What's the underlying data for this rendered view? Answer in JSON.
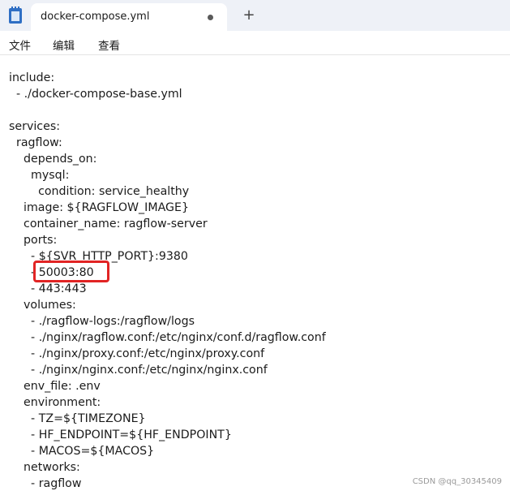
{
  "tab": {
    "title": "docker-compose.yml"
  },
  "menu": [
    "文件",
    "编辑",
    "查看"
  ],
  "lines": [
    "include:",
    "  - ./docker-compose-base.yml",
    "",
    "services:",
    "  ragflow:",
    "    depends_on:",
    "      mysql:",
    "        condition: service_healthy",
    "    image: ${RAGFLOW_IMAGE}",
    "    container_name: ragflow-server",
    "    ports:",
    "      - ${SVR_HTTP_PORT}:9380",
    "      - 50003:80",
    "      - 443:443",
    "    volumes:",
    "      - ./ragflow-logs:/ragflow/logs",
    "      - ./nginx/ragflow.conf:/etc/nginx/conf.d/ragflow.conf",
    "      - ./nginx/proxy.conf:/etc/nginx/proxy.conf",
    "      - ./nginx/nginx.conf:/etc/nginx/nginx.conf",
    "    env_file: .env",
    "    environment:",
    "      - TZ=${TIMEZONE}",
    "      - HF_ENDPOINT=${HF_ENDPOINT}",
    "      - MACOS=${MACOS}",
    "    networks:",
    "      - ragflow"
  ],
  "watermark": "CSDN @qq_30345409",
  "colors": {
    "highlight": "#e12424",
    "titlebar": "#eef1f7"
  }
}
